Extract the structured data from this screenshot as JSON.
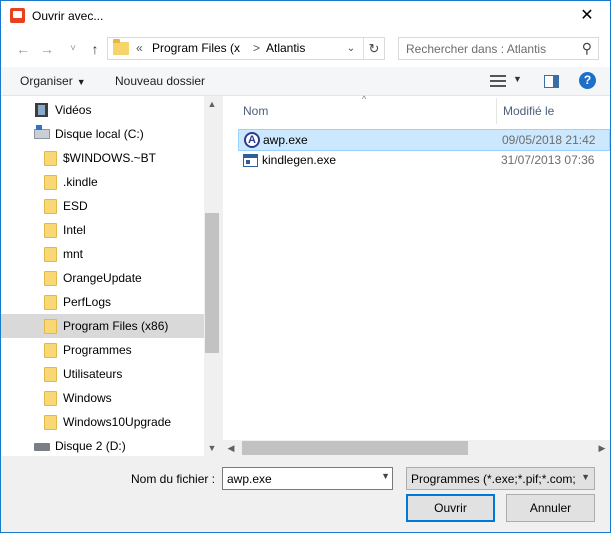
{
  "window": {
    "title": "Ouvrir avec..."
  },
  "navigation": {
    "back": "←",
    "forward": "→",
    "recent": "˅",
    "up": "↑",
    "address": {
      "overflow": "«",
      "segments": [
        "Program Files (x",
        "Atlantis"
      ],
      "separator": ">"
    },
    "search_placeholder": "Rechercher dans : Atlantis"
  },
  "toolbar": {
    "organize_label": "Organiser",
    "new_folder_label": "Nouveau dossier"
  },
  "tree": {
    "items": [
      {
        "label": "Vidéos",
        "type": "video"
      },
      {
        "label": "Disque local (C:)",
        "type": "drive"
      },
      {
        "label": "$WINDOWS.~BT",
        "type": "folder"
      },
      {
        "label": ".kindle",
        "type": "folder"
      },
      {
        "label": "ESD",
        "type": "folder"
      },
      {
        "label": "Intel",
        "type": "folder"
      },
      {
        "label": "mnt",
        "type": "folder"
      },
      {
        "label": "OrangeUpdate",
        "type": "folder"
      },
      {
        "label": "PerfLogs",
        "type": "folder"
      },
      {
        "label": "Program Files (x86)",
        "type": "folder",
        "selected": true
      },
      {
        "label": "Programmes",
        "type": "folder"
      },
      {
        "label": "Utilisateurs",
        "type": "folder"
      },
      {
        "label": "Windows",
        "type": "folder"
      },
      {
        "label": "Windows10Upgrade",
        "type": "folder"
      },
      {
        "label": "Disque 2 (D:)",
        "type": "drive2"
      }
    ]
  },
  "filelist": {
    "columns": {
      "name": "Nom",
      "modified": "Modifié le"
    },
    "files": [
      {
        "name": "awp.exe",
        "modified": "09/05/2018 21:42",
        "selected": true
      },
      {
        "name": "kindlegen.exe",
        "modified": "31/07/2013 07:36",
        "selected": false
      }
    ]
  },
  "footer": {
    "filename_label": "Nom du fichier :",
    "filename_value": "awp.exe",
    "filetype": "Programmes (*.exe;*.pif;*.com;",
    "open_label": "Ouvrir",
    "cancel_label": "Annuler"
  },
  "icons": {
    "app": "app-icon",
    "close": "close-icon",
    "refresh": "refresh-icon",
    "search": "search-icon",
    "help": "help-icon"
  },
  "colors": {
    "accent": "#0078d7",
    "selection": "#cce8ff",
    "tree_selection": "#d9d9d9"
  }
}
